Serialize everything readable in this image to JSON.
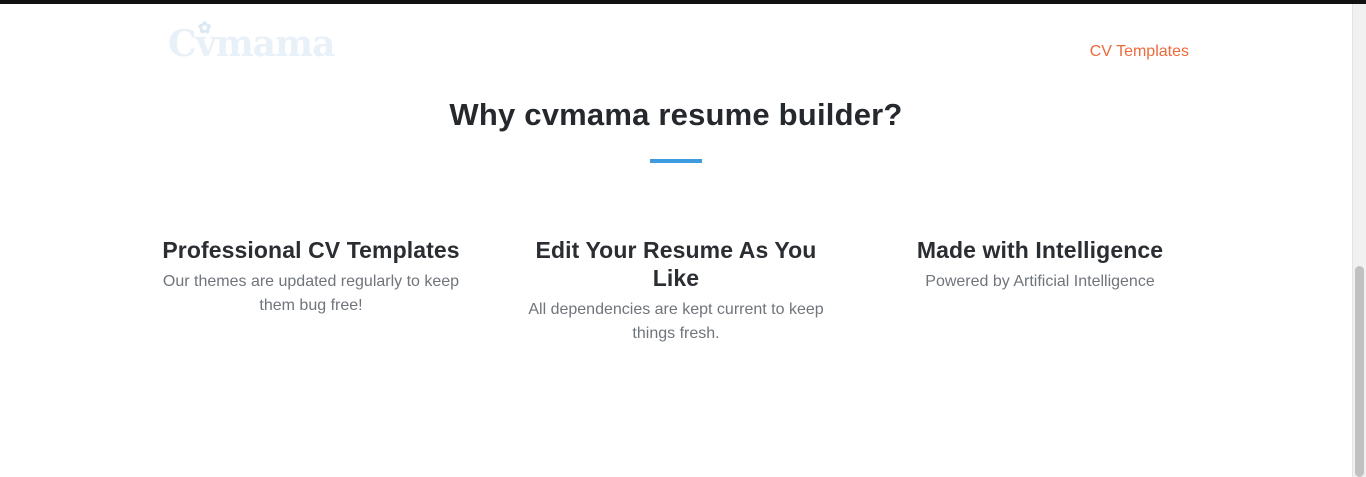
{
  "navbar": {
    "logo_text": "Cvmama",
    "links": [
      {
        "label": "CV Templates",
        "color": "#ec6a3c"
      }
    ]
  },
  "section": {
    "title": "Why cvmama resume builder?",
    "accent_color": "#3d9be0",
    "features": [
      {
        "title": "Professional CV Templates",
        "description": "Our themes are updated regularly to keep them bug free!"
      },
      {
        "title": "Edit Your Resume As You Like",
        "description": "All dependencies are kept current to keep things fresh."
      },
      {
        "title": "Made with Intelligence",
        "description": "Powered by Artificial Intelligence"
      }
    ]
  }
}
